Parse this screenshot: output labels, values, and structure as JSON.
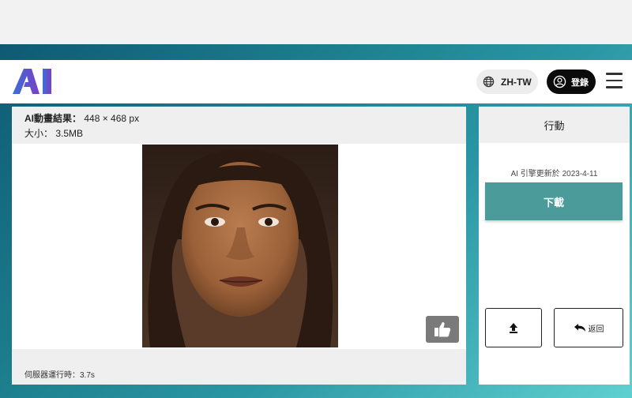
{
  "navbar": {
    "logo_text": "AI",
    "language_label": "ZH-TW",
    "login_label": "登錄"
  },
  "result": {
    "title_label": "AI動畫結果：",
    "dimensions": "448 × 468 px",
    "size_text": "大小： 3.5MB",
    "server_time": "伺服器運行時：3.7s"
  },
  "actions": {
    "title": "行動",
    "engine_note": "AI 引擎更新於 2023-4-11",
    "download_label": "下載",
    "back_label": "返回"
  },
  "icons": {
    "language": "globe-icon",
    "login": "user-circle-icon",
    "menu": "hamburger-menu-icon",
    "like": "thumbs-up-icon",
    "upload": "upload-icon",
    "back": "undo-arrow-icon"
  },
  "colors": {
    "accent": "#4a9b99",
    "login_bg": "#0b0b0b",
    "logo_gradient_start": "#3a6fd8",
    "logo_gradient_end": "#7b3fc4"
  }
}
